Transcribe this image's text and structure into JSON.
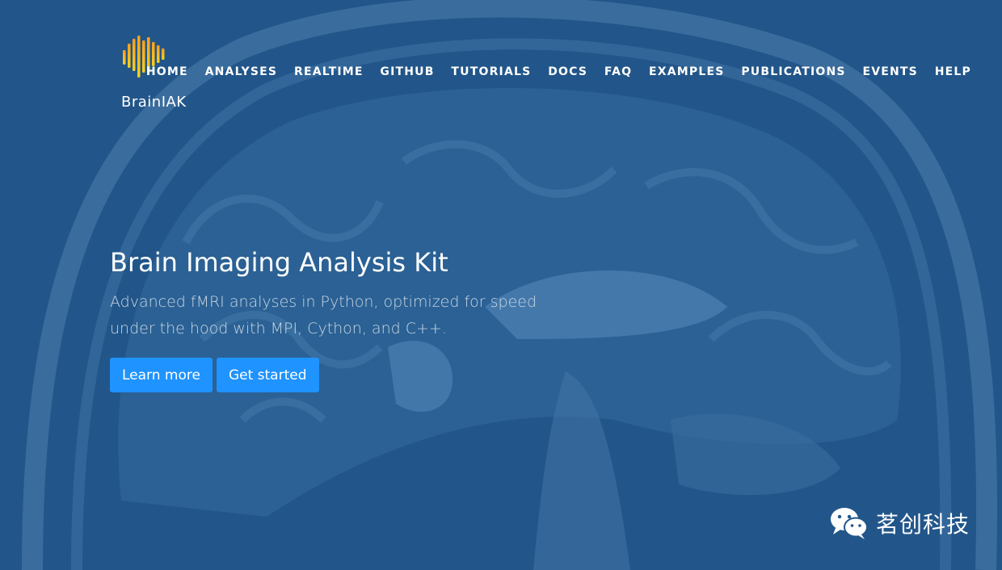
{
  "brand": {
    "name": "BrainIAK"
  },
  "nav": {
    "items": [
      {
        "label": "HOME"
      },
      {
        "label": "ANALYSES"
      },
      {
        "label": "REALTIME"
      },
      {
        "label": "GITHUB"
      },
      {
        "label": "TUTORIALS"
      },
      {
        "label": "DOCS"
      },
      {
        "label": "FAQ"
      },
      {
        "label": "EXAMPLES"
      },
      {
        "label": "PUBLICATIONS"
      },
      {
        "label": "EVENTS"
      },
      {
        "label": "HELP"
      }
    ]
  },
  "hero": {
    "title": "Brain Imaging Analysis Kit",
    "subtitle": "Advanced fMRI analyses in Python, optimized for speed under the hood with MPI, Cython, and C++.",
    "buttons": {
      "learn_more": "Learn more",
      "get_started": "Get started"
    }
  },
  "watermark": {
    "text": "茗创科技",
    "icon": "wechat-icon"
  },
  "colors": {
    "background": "#22568a",
    "button": "#1f93ff",
    "logo_gradient_top": "#ff9f1a",
    "logo_gradient_bottom": "#f5d020"
  }
}
